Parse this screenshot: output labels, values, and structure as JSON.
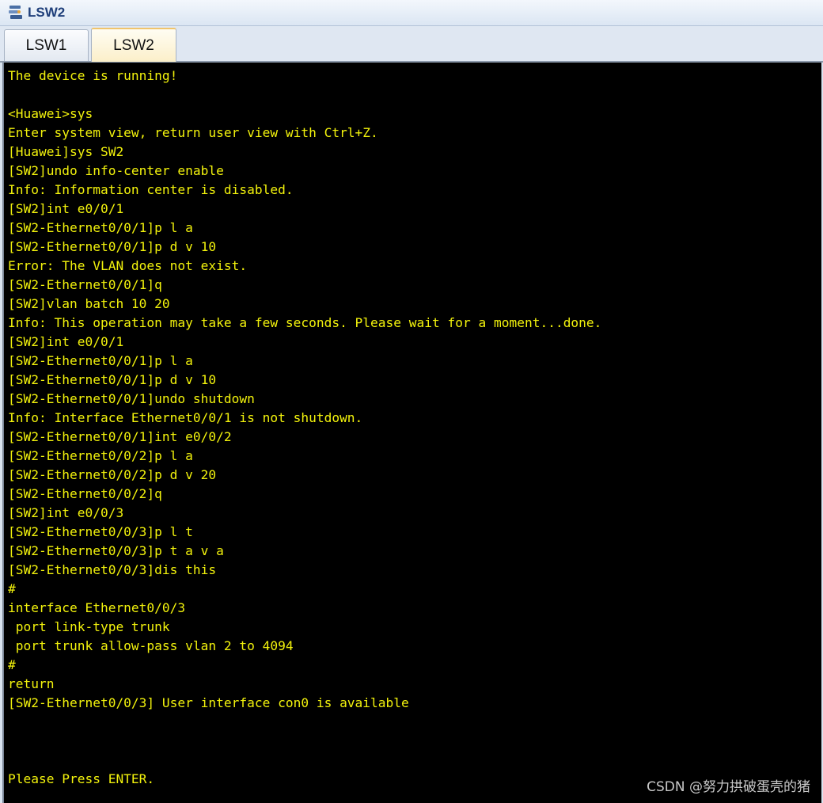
{
  "window": {
    "title": "LSW2",
    "icon": "network-device-icon"
  },
  "tabs": [
    {
      "label": "LSW1",
      "active": false
    },
    {
      "label": "LSW2",
      "active": true
    }
  ],
  "console": {
    "text_color": "#f2f20c",
    "background": "#000000",
    "lines": [
      "The device is running!",
      "",
      "<Huawei>sys",
      "Enter system view, return user view with Ctrl+Z.",
      "[Huawei]sys SW2",
      "[SW2]undo info-center enable",
      "Info: Information center is disabled.",
      "[SW2]int e0/0/1",
      "[SW2-Ethernet0/0/1]p l a",
      "[SW2-Ethernet0/0/1]p d v 10",
      "Error: The VLAN does not exist.",
      "[SW2-Ethernet0/0/1]q",
      "[SW2]vlan batch 10 20",
      "Info: This operation may take a few seconds. Please wait for a moment...done.",
      "[SW2]int e0/0/1",
      "[SW2-Ethernet0/0/1]p l a",
      "[SW2-Ethernet0/0/1]p d v 10",
      "[SW2-Ethernet0/0/1]undo shutdown",
      "Info: Interface Ethernet0/0/1 is not shutdown.",
      "[SW2-Ethernet0/0/1]int e0/0/2",
      "[SW2-Ethernet0/0/2]p l a",
      "[SW2-Ethernet0/0/2]p d v 20",
      "[SW2-Ethernet0/0/2]q",
      "[SW2]int e0/0/3",
      "[SW2-Ethernet0/0/3]p l t",
      "[SW2-Ethernet0/0/3]p t a v a",
      "[SW2-Ethernet0/0/3]dis this",
      "#",
      "interface Ethernet0/0/3",
      " port link-type trunk",
      " port trunk allow-pass vlan 2 to 4094",
      "#",
      "return",
      "[SW2-Ethernet0/0/3] User interface con0 is available",
      "",
      "",
      "",
      "Please Press ENTER."
    ]
  },
  "watermark": "CSDN @努力拱破蛋壳的猪"
}
